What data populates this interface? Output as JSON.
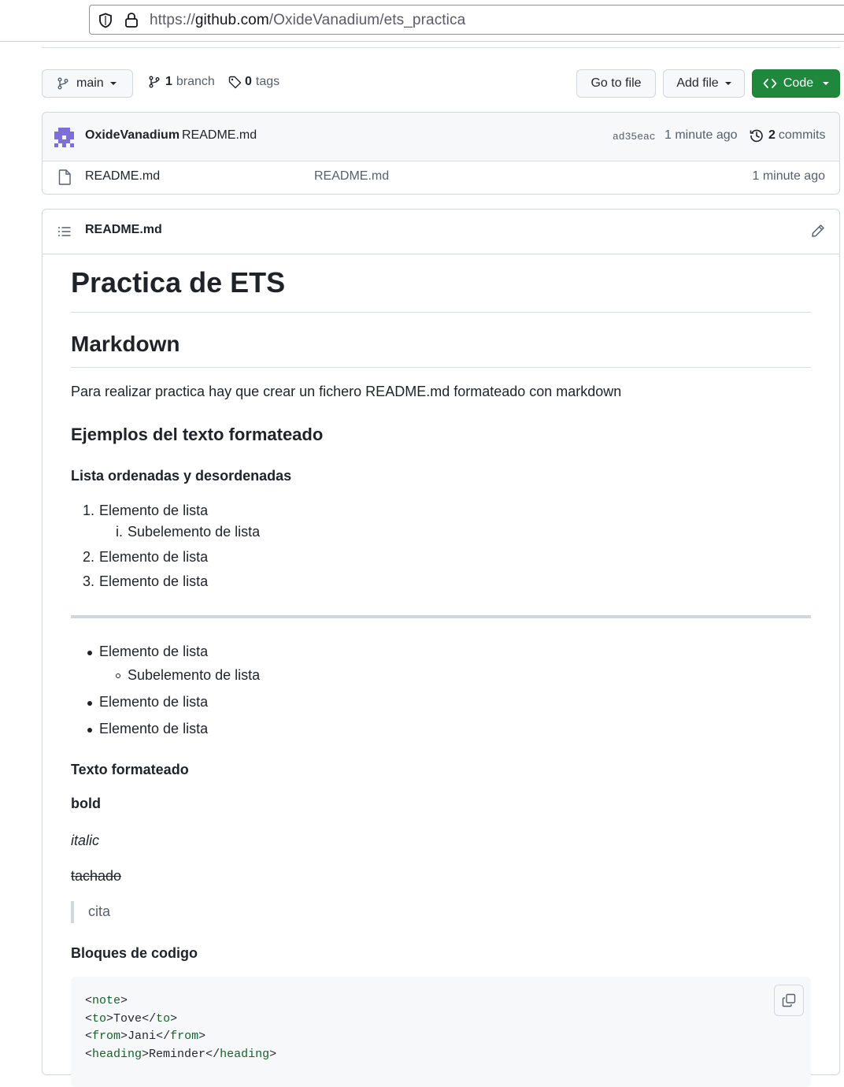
{
  "browser": {
    "url_prefix": "https://",
    "url_host": "github.com",
    "url_path": "/OxideVanadium/ets_practica"
  },
  "toolbar": {
    "branch_label": "main",
    "branch_count": "1",
    "branch_word": "branch",
    "tag_count": "0",
    "tag_word": "tags",
    "goto_file": "Go to file",
    "add_file": "Add file",
    "code": "Code",
    "code_button_color": "#1f883d"
  },
  "commit": {
    "author": "OxideVanadium",
    "message": "README.md",
    "sha": "ad35eac",
    "time": "1 minute ago",
    "commit_count": "2",
    "commit_word": "commits"
  },
  "files": [
    {
      "icon": "file-icon",
      "name": "README.md",
      "message": "README.md",
      "time": "1 minute ago"
    }
  ],
  "readme": {
    "header_title": "README.md",
    "h1": "Practica de ETS",
    "h2": "Markdown",
    "paragraph": "Para realizar practica hay que crear un fichero README.md formateado con markdown",
    "h3": "Ejemplos del texto formateado",
    "h4_lists": "Lista ordenadas y desordenadas",
    "ordered": [
      {
        "marker": "1.",
        "text": "Elemento de lista"
      },
      {
        "marker": "i.",
        "text": "Subelemento de lista"
      },
      {
        "marker": "2.",
        "text": "Elemento de lista"
      },
      {
        "marker": "3.",
        "text": "Elemento de lista"
      }
    ],
    "unordered": [
      {
        "text": "Elemento de lista"
      },
      {
        "text": "Subelemento de lista"
      },
      {
        "text": "Elemento de lista"
      },
      {
        "text": "Elemento de lista"
      }
    ],
    "h4_format": "Texto formateado",
    "bold": "bold",
    "italic": "italic",
    "strike": "tachado",
    "quote": "cita",
    "h4_code": "Bloques de codigo",
    "code_lines": [
      {
        "open": "note",
        "text": "",
        "close": ""
      },
      {
        "open": "to",
        "text": "Tove",
        "close": "to"
      },
      {
        "open": "from",
        "text": "Jani",
        "close": "from"
      },
      {
        "open": "heading",
        "text": "Reminder",
        "close": "heading"
      }
    ]
  }
}
